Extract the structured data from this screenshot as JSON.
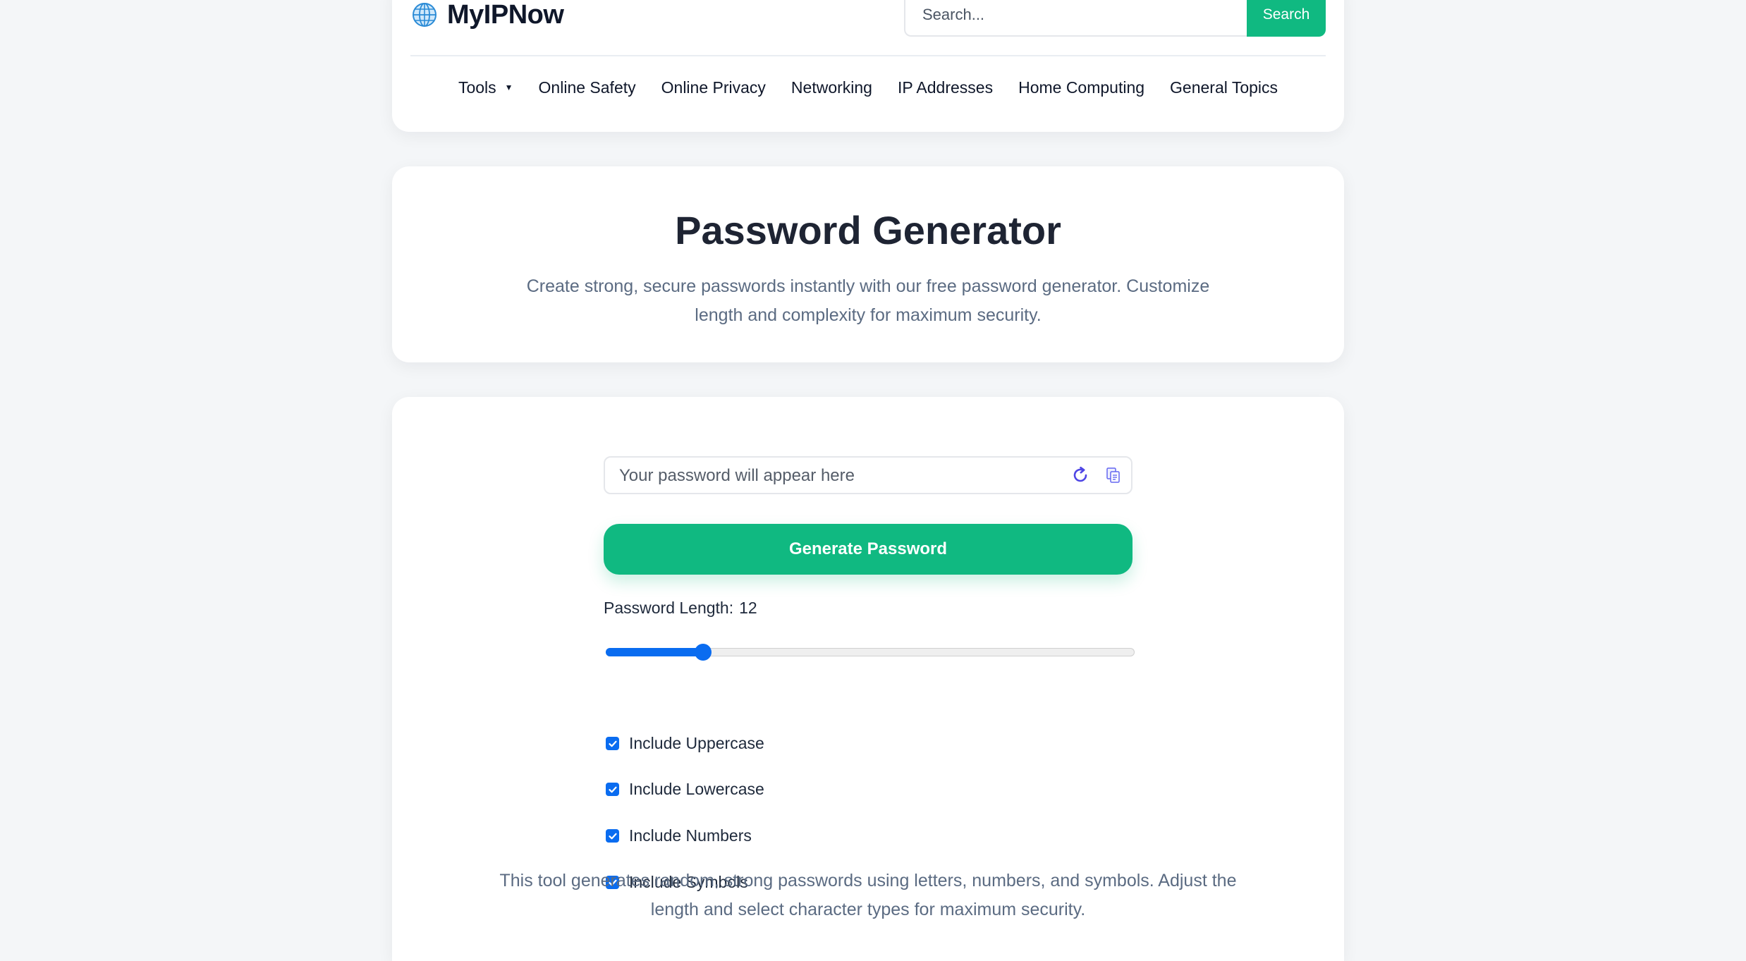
{
  "brand": {
    "name": "MyIPNow",
    "icon": "globe-icon"
  },
  "search": {
    "placeholder": "Search...",
    "button_label": "Search"
  },
  "nav": {
    "items": [
      {
        "label": "Tools",
        "has_dropdown": true
      },
      {
        "label": "Online Safety"
      },
      {
        "label": "Online Privacy"
      },
      {
        "label": "Networking"
      },
      {
        "label": "IP Addresses"
      },
      {
        "label": "Home Computing"
      },
      {
        "label": "General Topics"
      }
    ],
    "dropdown_caret": "▼"
  },
  "hero": {
    "title": "Password Generator",
    "subtitle": "Create strong, secure passwords instantly with our free password generator. Customize length and complexity for maximum security."
  },
  "generator": {
    "password_placeholder": "Your password will appear here",
    "password_value": "",
    "refresh_icon": "refresh-icon",
    "copy_icon": "copy-icon",
    "generate_label": "Generate Password",
    "length_label": "Password Length:",
    "length_value": "12",
    "slider": {
      "min": 4,
      "max": 50,
      "value": 12
    },
    "options": [
      {
        "label": "Include Uppercase",
        "checked": true
      },
      {
        "label": "Include Lowercase",
        "checked": true
      },
      {
        "label": "Include Numbers",
        "checked": true
      },
      {
        "label": "Include Symbols",
        "checked": true
      }
    ],
    "description": "This tool generates random, strong passwords using letters, numbers, and symbols. Adjust the length and select character types for maximum security."
  },
  "colors": {
    "accent": "#10b981",
    "control_blue": "#0a6cf0",
    "page_bg": "#f4f6f8",
    "muted_text": "#5b6b82",
    "icon_purple": "#4f46e5"
  }
}
